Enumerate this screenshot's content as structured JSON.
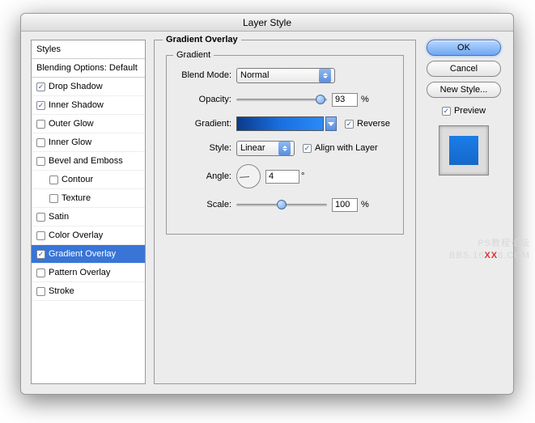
{
  "title": "Layer Style",
  "stylesHeader": "Styles",
  "blendingOptions": "Blending Options: Default",
  "effects": [
    {
      "label": "Drop Shadow",
      "checked": true
    },
    {
      "label": "Inner Shadow",
      "checked": true
    },
    {
      "label": "Outer Glow",
      "checked": false
    },
    {
      "label": "Inner Glow",
      "checked": false
    },
    {
      "label": "Bevel and Emboss",
      "checked": false
    },
    {
      "label": "Contour",
      "checked": false,
      "indent": true
    },
    {
      "label": "Texture",
      "checked": false,
      "indent": true
    },
    {
      "label": "Satin",
      "checked": false
    },
    {
      "label": "Color Overlay",
      "checked": false
    },
    {
      "label": "Gradient Overlay",
      "checked": true,
      "selected": true
    },
    {
      "label": "Pattern Overlay",
      "checked": false
    },
    {
      "label": "Stroke",
      "checked": false
    }
  ],
  "panel": {
    "sectionTitle": "Gradient Overlay",
    "groupTitle": "Gradient",
    "blendModeLabel": "Blend Mode:",
    "blendModeValue": "Normal",
    "opacityLabel": "Opacity:",
    "opacityValue": "93",
    "opacityPct": 93,
    "percent": "%",
    "gradientLabel": "Gradient:",
    "reverseLabel": "Reverse",
    "reverseChecked": true,
    "styleLabel": "Style:",
    "styleValue": "Linear",
    "alignLabel": "Align with Layer",
    "alignChecked": true,
    "angleLabel": "Angle:",
    "angleValue": "4",
    "degree": "°",
    "scaleLabel": "Scale:",
    "scaleValue": "100",
    "scalePct": 50
  },
  "buttons": {
    "ok": "OK",
    "cancel": "Cancel",
    "newStyle": "New Style...",
    "preview": "Preview",
    "previewChecked": true
  },
  "watermark": {
    "line1": "PS教程论坛",
    "line2a": "BBS.16",
    "line2xx": "XX",
    "line2b": "8.COM"
  }
}
